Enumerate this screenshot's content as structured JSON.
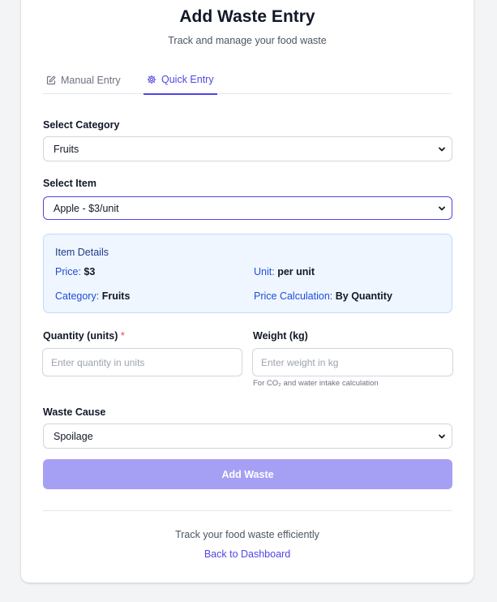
{
  "header": {
    "title": "Add Waste Entry",
    "subtitle": "Track and manage your food waste"
  },
  "tabs": [
    {
      "label": "Manual Entry",
      "icon": "edit-icon",
      "active": false
    },
    {
      "label": "Quick Entry",
      "icon": "gear-icon",
      "active": true
    }
  ],
  "form": {
    "category": {
      "label": "Select Category",
      "value": "Fruits"
    },
    "item": {
      "label": "Select Item",
      "value": "Apple - $3/unit"
    },
    "details": {
      "title": "Item Details",
      "price_label": "Price:",
      "price_value": "$3",
      "unit_label": "Unit:",
      "unit_value": "per unit",
      "category_label": "Category:",
      "category_value": "Fruits",
      "calc_label": "Price Calculation:",
      "calc_value": "By Quantity"
    },
    "quantity": {
      "label": "Quantity (units)",
      "required_mark": "*",
      "placeholder": "Enter quantity in units"
    },
    "weight": {
      "label": "Weight (kg)",
      "placeholder": "Enter weight in kg",
      "hint": "For CO₂ and water intake calculation"
    },
    "cause": {
      "label": "Waste Cause",
      "value": "Spoilage"
    },
    "submit_label": "Add Waste"
  },
  "footer": {
    "text": "Track your food waste efficiently",
    "link": "Back to Dashboard"
  },
  "colors": {
    "accent": "#4f46e5",
    "button_disabled": "#a5a0f3",
    "details_bg": "#eff6ff",
    "details_border": "#bfdbfe",
    "required": "#ef4444"
  }
}
